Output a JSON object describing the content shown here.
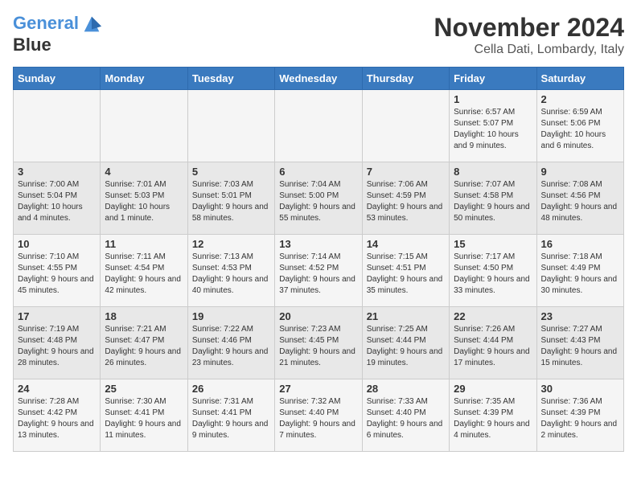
{
  "header": {
    "logo_line1": "General",
    "logo_line2": "Blue",
    "month_title": "November 2024",
    "location": "Cella Dati, Lombardy, Italy"
  },
  "weekdays": [
    "Sunday",
    "Monday",
    "Tuesday",
    "Wednesday",
    "Thursday",
    "Friday",
    "Saturday"
  ],
  "weeks": [
    [
      {
        "day": "",
        "info": ""
      },
      {
        "day": "",
        "info": ""
      },
      {
        "day": "",
        "info": ""
      },
      {
        "day": "",
        "info": ""
      },
      {
        "day": "",
        "info": ""
      },
      {
        "day": "1",
        "info": "Sunrise: 6:57 AM\nSunset: 5:07 PM\nDaylight: 10 hours and 9 minutes."
      },
      {
        "day": "2",
        "info": "Sunrise: 6:59 AM\nSunset: 5:06 PM\nDaylight: 10 hours and 6 minutes."
      }
    ],
    [
      {
        "day": "3",
        "info": "Sunrise: 7:00 AM\nSunset: 5:04 PM\nDaylight: 10 hours and 4 minutes."
      },
      {
        "day": "4",
        "info": "Sunrise: 7:01 AM\nSunset: 5:03 PM\nDaylight: 10 hours and 1 minute."
      },
      {
        "day": "5",
        "info": "Sunrise: 7:03 AM\nSunset: 5:01 PM\nDaylight: 9 hours and 58 minutes."
      },
      {
        "day": "6",
        "info": "Sunrise: 7:04 AM\nSunset: 5:00 PM\nDaylight: 9 hours and 55 minutes."
      },
      {
        "day": "7",
        "info": "Sunrise: 7:06 AM\nSunset: 4:59 PM\nDaylight: 9 hours and 53 minutes."
      },
      {
        "day": "8",
        "info": "Sunrise: 7:07 AM\nSunset: 4:58 PM\nDaylight: 9 hours and 50 minutes."
      },
      {
        "day": "9",
        "info": "Sunrise: 7:08 AM\nSunset: 4:56 PM\nDaylight: 9 hours and 48 minutes."
      }
    ],
    [
      {
        "day": "10",
        "info": "Sunrise: 7:10 AM\nSunset: 4:55 PM\nDaylight: 9 hours and 45 minutes."
      },
      {
        "day": "11",
        "info": "Sunrise: 7:11 AM\nSunset: 4:54 PM\nDaylight: 9 hours and 42 minutes."
      },
      {
        "day": "12",
        "info": "Sunrise: 7:13 AM\nSunset: 4:53 PM\nDaylight: 9 hours and 40 minutes."
      },
      {
        "day": "13",
        "info": "Sunrise: 7:14 AM\nSunset: 4:52 PM\nDaylight: 9 hours and 37 minutes."
      },
      {
        "day": "14",
        "info": "Sunrise: 7:15 AM\nSunset: 4:51 PM\nDaylight: 9 hours and 35 minutes."
      },
      {
        "day": "15",
        "info": "Sunrise: 7:17 AM\nSunset: 4:50 PM\nDaylight: 9 hours and 33 minutes."
      },
      {
        "day": "16",
        "info": "Sunrise: 7:18 AM\nSunset: 4:49 PM\nDaylight: 9 hours and 30 minutes."
      }
    ],
    [
      {
        "day": "17",
        "info": "Sunrise: 7:19 AM\nSunset: 4:48 PM\nDaylight: 9 hours and 28 minutes."
      },
      {
        "day": "18",
        "info": "Sunrise: 7:21 AM\nSunset: 4:47 PM\nDaylight: 9 hours and 26 minutes."
      },
      {
        "day": "19",
        "info": "Sunrise: 7:22 AM\nSunset: 4:46 PM\nDaylight: 9 hours and 23 minutes."
      },
      {
        "day": "20",
        "info": "Sunrise: 7:23 AM\nSunset: 4:45 PM\nDaylight: 9 hours and 21 minutes."
      },
      {
        "day": "21",
        "info": "Sunrise: 7:25 AM\nSunset: 4:44 PM\nDaylight: 9 hours and 19 minutes."
      },
      {
        "day": "22",
        "info": "Sunrise: 7:26 AM\nSunset: 4:44 PM\nDaylight: 9 hours and 17 minutes."
      },
      {
        "day": "23",
        "info": "Sunrise: 7:27 AM\nSunset: 4:43 PM\nDaylight: 9 hours and 15 minutes."
      }
    ],
    [
      {
        "day": "24",
        "info": "Sunrise: 7:28 AM\nSunset: 4:42 PM\nDaylight: 9 hours and 13 minutes."
      },
      {
        "day": "25",
        "info": "Sunrise: 7:30 AM\nSunset: 4:41 PM\nDaylight: 9 hours and 11 minutes."
      },
      {
        "day": "26",
        "info": "Sunrise: 7:31 AM\nSunset: 4:41 PM\nDaylight: 9 hours and 9 minutes."
      },
      {
        "day": "27",
        "info": "Sunrise: 7:32 AM\nSunset: 4:40 PM\nDaylight: 9 hours and 7 minutes."
      },
      {
        "day": "28",
        "info": "Sunrise: 7:33 AM\nSunset: 4:40 PM\nDaylight: 9 hours and 6 minutes."
      },
      {
        "day": "29",
        "info": "Sunrise: 7:35 AM\nSunset: 4:39 PM\nDaylight: 9 hours and 4 minutes."
      },
      {
        "day": "30",
        "info": "Sunrise: 7:36 AM\nSunset: 4:39 PM\nDaylight: 9 hours and 2 minutes."
      }
    ]
  ]
}
